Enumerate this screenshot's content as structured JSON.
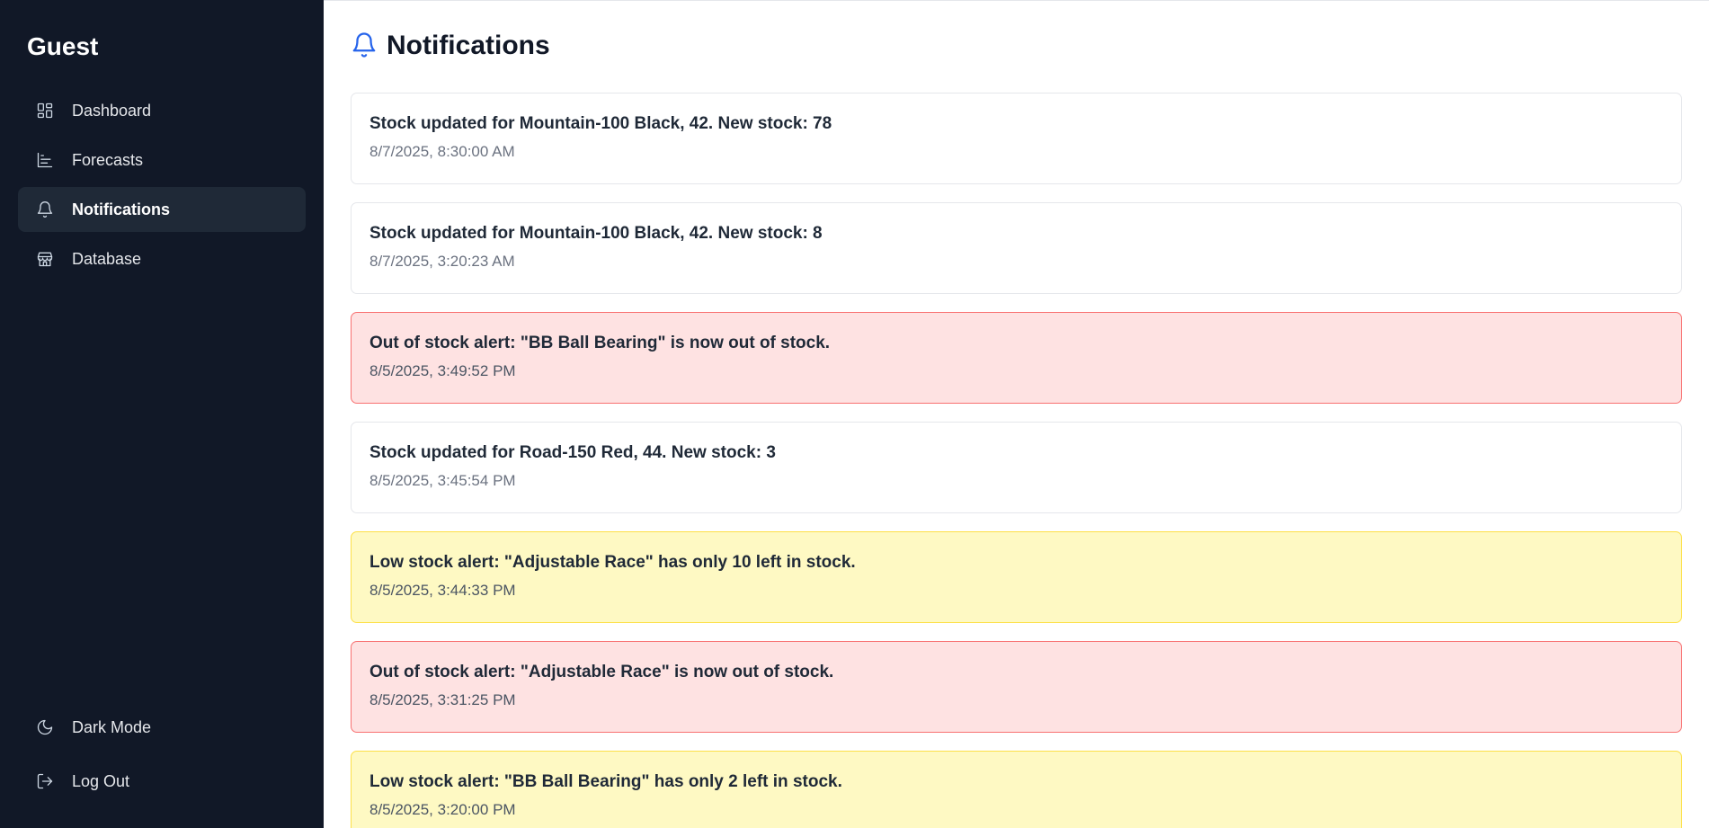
{
  "sidebar": {
    "title": "Guest",
    "items": [
      {
        "label": "Dashboard",
        "icon": "dashboard-icon"
      },
      {
        "label": "Forecasts",
        "icon": "chart-icon"
      },
      {
        "label": "Notifications",
        "icon": "bell-icon",
        "active": true
      },
      {
        "label": "Database",
        "icon": "store-icon"
      }
    ],
    "bottom": [
      {
        "label": "Dark Mode",
        "icon": "moon-icon"
      },
      {
        "label": "Log Out",
        "icon": "logout-icon"
      }
    ]
  },
  "header": {
    "title": "Notifications",
    "icon": "bell-icon"
  },
  "notifications": [
    {
      "message": "Stock updated for Mountain-100 Black, 42. New stock: 78",
      "time": "8/7/2025, 8:30:00 AM",
      "type": "info"
    },
    {
      "message": "Stock updated for Mountain-100 Black, 42. New stock: 8",
      "time": "8/7/2025, 3:20:23 AM",
      "type": "info"
    },
    {
      "message": "Out of stock alert: \"BB Ball Bearing\" is now out of stock.",
      "time": "8/5/2025, 3:49:52 PM",
      "type": "error"
    },
    {
      "message": "Stock updated for Road-150 Red, 44. New stock: 3",
      "time": "8/5/2025, 3:45:54 PM",
      "type": "info"
    },
    {
      "message": "Low stock alert: \"Adjustable Race\" has only 10 left in stock.",
      "time": "8/5/2025, 3:44:33 PM",
      "type": "warning"
    },
    {
      "message": "Out of stock alert: \"Adjustable Race\" is now out of stock.",
      "time": "8/5/2025, 3:31:25 PM",
      "type": "error"
    },
    {
      "message": "Low stock alert: \"BB Ball Bearing\" has only 2 left in stock.",
      "time": "8/5/2025, 3:20:00 PM",
      "type": "warning"
    }
  ],
  "colors": {
    "sidebar_bg": "#111827",
    "active_item_bg": "#1f2937",
    "accent": "#2563eb",
    "error_bg": "#fee2e2",
    "error_border": "#f87171",
    "warning_bg": "#fef9c3",
    "warning_border": "#fde047"
  }
}
